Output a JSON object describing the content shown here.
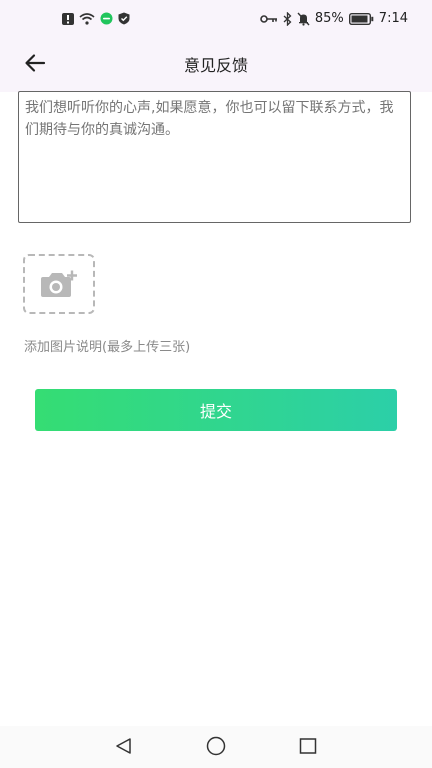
{
  "status_bar": {
    "battery_percent": "85%",
    "time": "7:14"
  },
  "header": {
    "title": "意见反馈"
  },
  "feedback": {
    "placeholder": "我们想听听你的心声,如果愿意，你也可以留下联系方式，我们期待与你的真诚沟通。"
  },
  "image_upload": {
    "hint": "添加图片说明(最多上传三张)"
  },
  "actions": {
    "submit_label": "提交"
  },
  "colors": {
    "header_bg": "#f9f4fb",
    "submit_gradient_start": "#35dd73",
    "submit_gradient_end": "#2ccfa8"
  },
  "icons": {
    "back": "arrow-left",
    "upload": "camera-plus",
    "nav": [
      "triangle-back",
      "circle-home",
      "square-recents"
    ]
  }
}
